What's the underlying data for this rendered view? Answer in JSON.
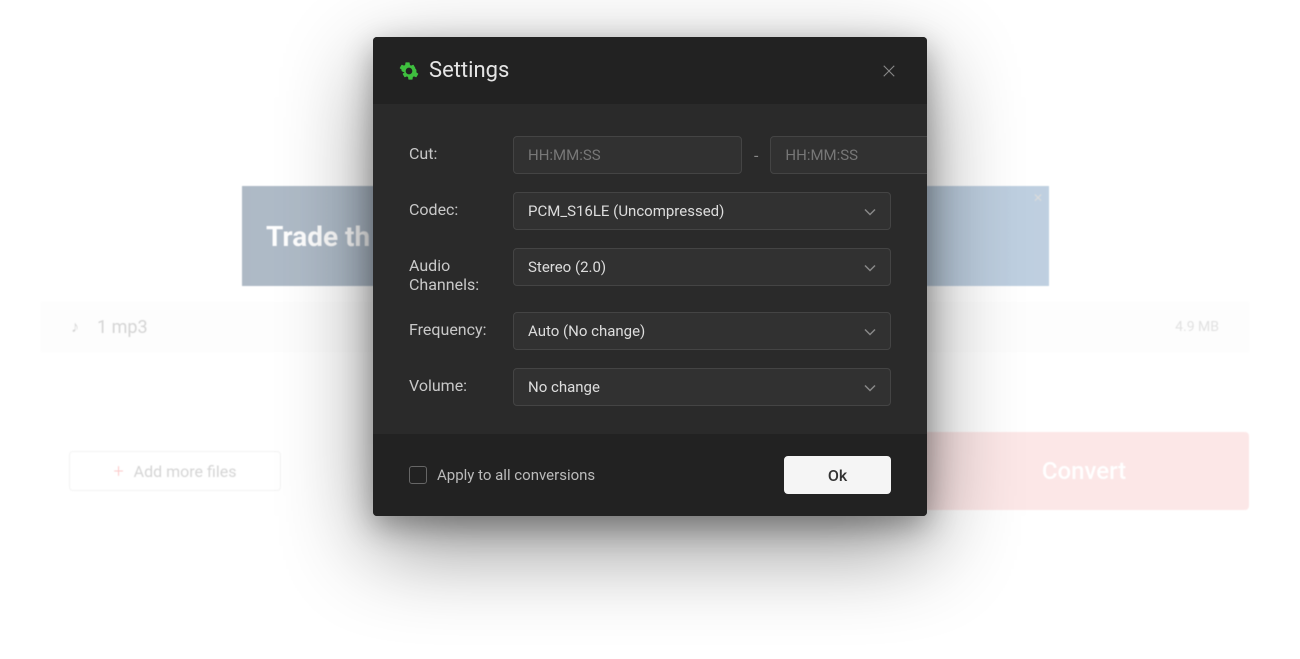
{
  "background": {
    "banner_title": "Trade th",
    "file_name": "1 mp3",
    "file_size": "4.9 MB",
    "add_more_label": "Add more files",
    "convert_label": "Convert"
  },
  "modal": {
    "title": "Settings",
    "fields": {
      "cut": {
        "label": "Cut:",
        "placeholder_start": "HH:MM:SS",
        "placeholder_end": "HH:MM:SS",
        "separator": "-"
      },
      "codec": {
        "label": "Codec:",
        "value": "PCM_S16LE (Uncompressed)"
      },
      "audio_channels": {
        "label": "Audio Channels:",
        "value": "Stereo (2.0)"
      },
      "frequency": {
        "label": "Frequency:",
        "value": "Auto (No change)"
      },
      "volume": {
        "label": "Volume:",
        "value": "No change"
      }
    },
    "footer": {
      "apply_all_label": "Apply to all conversions",
      "ok_label": "Ok"
    }
  }
}
